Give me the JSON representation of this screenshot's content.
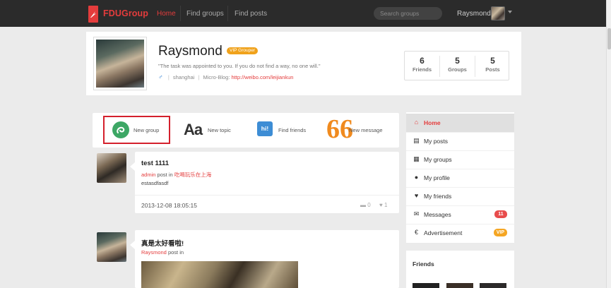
{
  "navbar": {
    "brand": "FDUGroup",
    "links": [
      "Home",
      "Find groups",
      "Find posts"
    ],
    "search_placeholder": "Search groups",
    "user_name": "Raysmond"
  },
  "profile": {
    "name": "Raysmond",
    "badge": "VIP Grouper",
    "quote": "\"The task was appointed to you. If you do not find a way, no one will.\"",
    "location": "shanghai",
    "blog_label": "Micro-Blog:",
    "blog_url": "http://weibo.com/leijiankun",
    "stats": [
      {
        "value": "6",
        "label": "Friends"
      },
      {
        "value": "5",
        "label": "Groups"
      },
      {
        "value": "5",
        "label": "Posts"
      }
    ]
  },
  "actions": {
    "new_group": "New group",
    "new_topic": "New topic",
    "topic_glyph": "Aa",
    "find_friends": "Find friends",
    "friends_glyph": "hi!",
    "new_message": "New message",
    "message_glyph": "66"
  },
  "posts": [
    {
      "title": "test 1111",
      "author": "admin",
      "posted_in_text": "post in",
      "group": "吃喝玩乐在上海",
      "body": "estasdfasdf",
      "date": "2013-12-08 18:05:15",
      "comments": "0",
      "likes": "1"
    },
    {
      "title": "真是太好看啦!",
      "author": "Raysmond",
      "posted_in_text": "post in",
      "group": ""
    }
  ],
  "sidebar": {
    "items": [
      {
        "label": "Home",
        "icon": "home-icon",
        "glyph": "⌂"
      },
      {
        "label": "My posts",
        "icon": "posts-icon",
        "glyph": "▤"
      },
      {
        "label": "My groups",
        "icon": "groups-icon",
        "glyph": "▦"
      },
      {
        "label": "My profile",
        "icon": "user-icon",
        "glyph": "●"
      },
      {
        "label": "My friends",
        "icon": "heart-icon",
        "glyph": "♥"
      },
      {
        "label": "Messages",
        "icon": "envelope-icon",
        "glyph": "✉",
        "badge": "11"
      },
      {
        "label": "Advertisement",
        "icon": "euro-icon",
        "glyph": "€",
        "badge": "VIP"
      }
    ],
    "friends_title": "Friends"
  },
  "colors": {
    "brand_red": "#e43c3c",
    "badge_orange": "#f0a21b",
    "messages_badge": "#e84c4c",
    "vip_badge": "#f5a623"
  }
}
